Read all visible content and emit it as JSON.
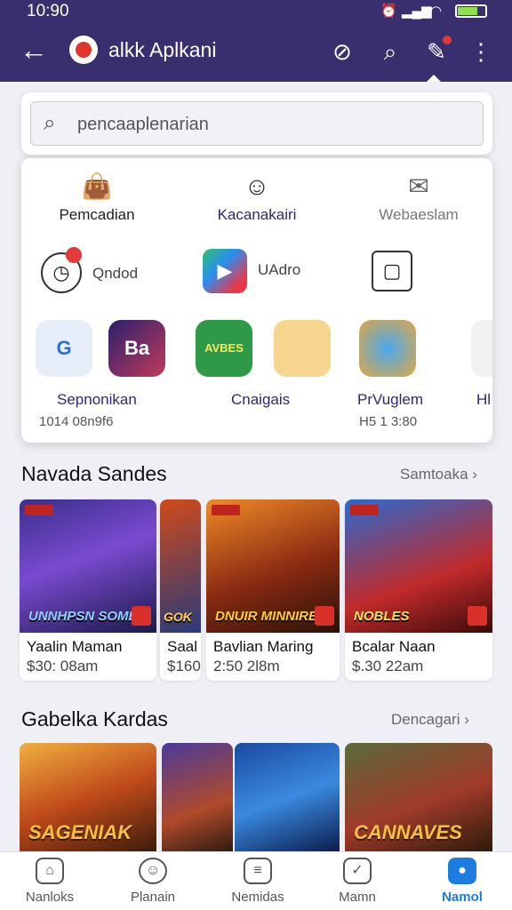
{
  "status": {
    "time": "10:90"
  },
  "appbar": {
    "title": "alkk Aplkani"
  },
  "search": {
    "value": "pencaaplenarian"
  },
  "menu": {
    "top": [
      {
        "label": "Pemcadian",
        "icon": "shopping-bag-icon"
      },
      {
        "label": "Kacanakairi",
        "icon": "chat-icon"
      },
      {
        "label": "Webaeslam",
        "icon": "mail-icon"
      }
    ],
    "row2": [
      {
        "label": "Qndod",
        "icon": "clock-icon"
      },
      {
        "label": "UAdro",
        "icon": "play-store-icon"
      },
      {
        "label": "",
        "icon": "box-icon"
      }
    ],
    "apps": [
      {
        "name": "Sepnonikan",
        "size": "1014 08n9f6",
        "icon_text": "G"
      },
      {
        "name": "",
        "size": "",
        "icon_text": "Ba"
      },
      {
        "name": "Cnaigais",
        "size": "",
        "icon_text": "AVBES"
      },
      {
        "name": "",
        "size": "",
        "icon_text": ""
      },
      {
        "name": "PrVuglem",
        "size": "H5 1 3:80",
        "icon_text": ""
      },
      {
        "name": "Hl",
        "size": "",
        "icon_text": ""
      }
    ]
  },
  "section1": {
    "title": "Navada Sandes",
    "see_more": "Samtoaka",
    "cards": [
      {
        "name": "Yaalin Maman",
        "price": "$30: 08am",
        "thumb_text": "UNNHPSN SOMES"
      },
      {
        "name": "Saal",
        "price": "$160",
        "thumb_text": "GOK"
      },
      {
        "name": "Bavlian Maring",
        "price": "2:50 2l8m",
        "thumb_text": "DNUIR MINNIRE"
      },
      {
        "name": "Bcalar Naan",
        "price": "$.30 22am",
        "thumb_text": "NOBLES"
      }
    ]
  },
  "section2": {
    "title": "Gabelka Kardas",
    "see_more": "Dencagari",
    "cards": [
      {
        "thumb_text": "SAGENIAK"
      },
      {
        "thumb_text": ""
      },
      {
        "thumb_text": ""
      },
      {
        "thumb_text": "CANNAVES"
      }
    ]
  },
  "nav": [
    {
      "label": "Nanloks",
      "icon": "home-icon"
    },
    {
      "label": "Planain",
      "icon": "face-icon"
    },
    {
      "label": "Nemidas",
      "icon": "message-icon"
    },
    {
      "label": "Mamn",
      "icon": "chat-badge-icon"
    },
    {
      "label": "Namol",
      "icon": "profile-icon"
    }
  ],
  "colors": {
    "appbar": "#3a2f6e",
    "accent": "#1c7ce0",
    "badge": "#e03a3a"
  }
}
